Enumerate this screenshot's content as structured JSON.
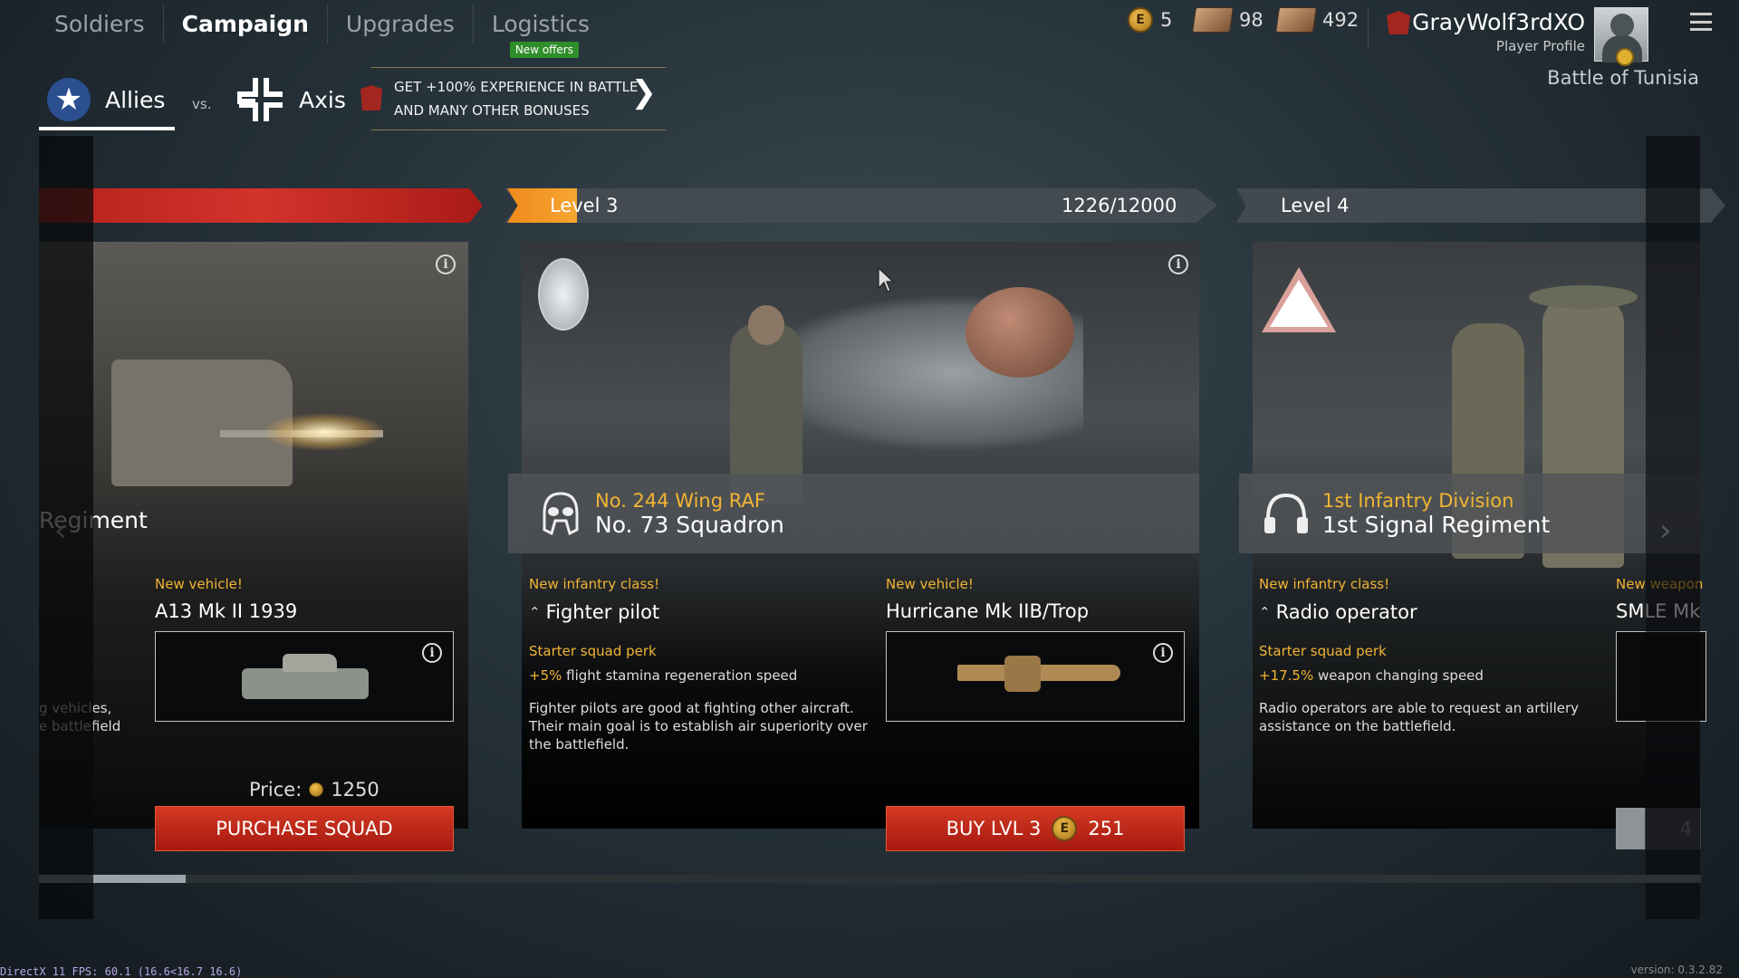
{
  "nav": {
    "tabs": [
      "Soldiers",
      "Campaign",
      "Upgrades",
      "Logistics"
    ],
    "new_offers": "New offers"
  },
  "currency": {
    "gold": "5",
    "tickets": "98",
    "cards": "492"
  },
  "player": {
    "name": "GrayWolf3rdXO",
    "subtitle": "Player Profile",
    "campaign": "Battle of Tunisia"
  },
  "factions": {
    "allies": "Allies",
    "vs": "vs.",
    "axis": "Axis"
  },
  "promo": {
    "line1": "GET +100% EXPERIENCE IN BATTLE",
    "line2": "AND MANY OTHER BONUSES"
  },
  "levels": {
    "current": "Level 3",
    "progress": "1226/12000",
    "progress_fraction": 0.102,
    "next": "Level 4"
  },
  "left_card": {
    "unit_partial": "Regiment",
    "new_label": "New vehicle!",
    "vehicle": "A13 Mk II 1939",
    "desc_line1": "g vehicles,",
    "desc_line2": "e battlefield",
    "price_label": "Price:",
    "price": "1250",
    "button": "PURCHASE SQUAD"
  },
  "center_card": {
    "unit_top": "No. 244 Wing RAF",
    "unit_main": "No. 73 Squadron",
    "class_label": "New infantry class!",
    "class_name": "Fighter pilot",
    "perk_label": "Starter squad perk",
    "perk_value": "+5%",
    "perk_text": "flight stamina regeneration speed",
    "desc": "Fighter pilots are good at fighting other aircraft. Their main goal is to establish air superiority over the battlefield.",
    "vehicle_label": "New vehicle!",
    "vehicle_name": "Hurricane Mk IIB/Trop",
    "buy_label": "BUY LVL 3",
    "buy_price": "251"
  },
  "right_card": {
    "unit_top": "1st Infantry Division",
    "unit_main": "1st Signal Regiment",
    "class_label": "New infantry class!",
    "class_name": "Radio operator",
    "perk_label": "Starter squad perk",
    "perk_value": "+17.5%",
    "perk_text": "weapon changing speed",
    "desc": "Radio operators are able to request an artillery assistance on the battlefield.",
    "weapon_label": "New weapon",
    "weapon_name": "SMLE Mk",
    "badge_num": "4"
  },
  "footer": {
    "fps": "DirectX 11 FPS: 60.1 (16.6<16.7 16.6)",
    "version": "version: 0.3.2.82"
  },
  "colors": {
    "accent_orange": "#f2b533",
    "button_red": "#c62a1a",
    "level_orange": "#f29a28"
  }
}
